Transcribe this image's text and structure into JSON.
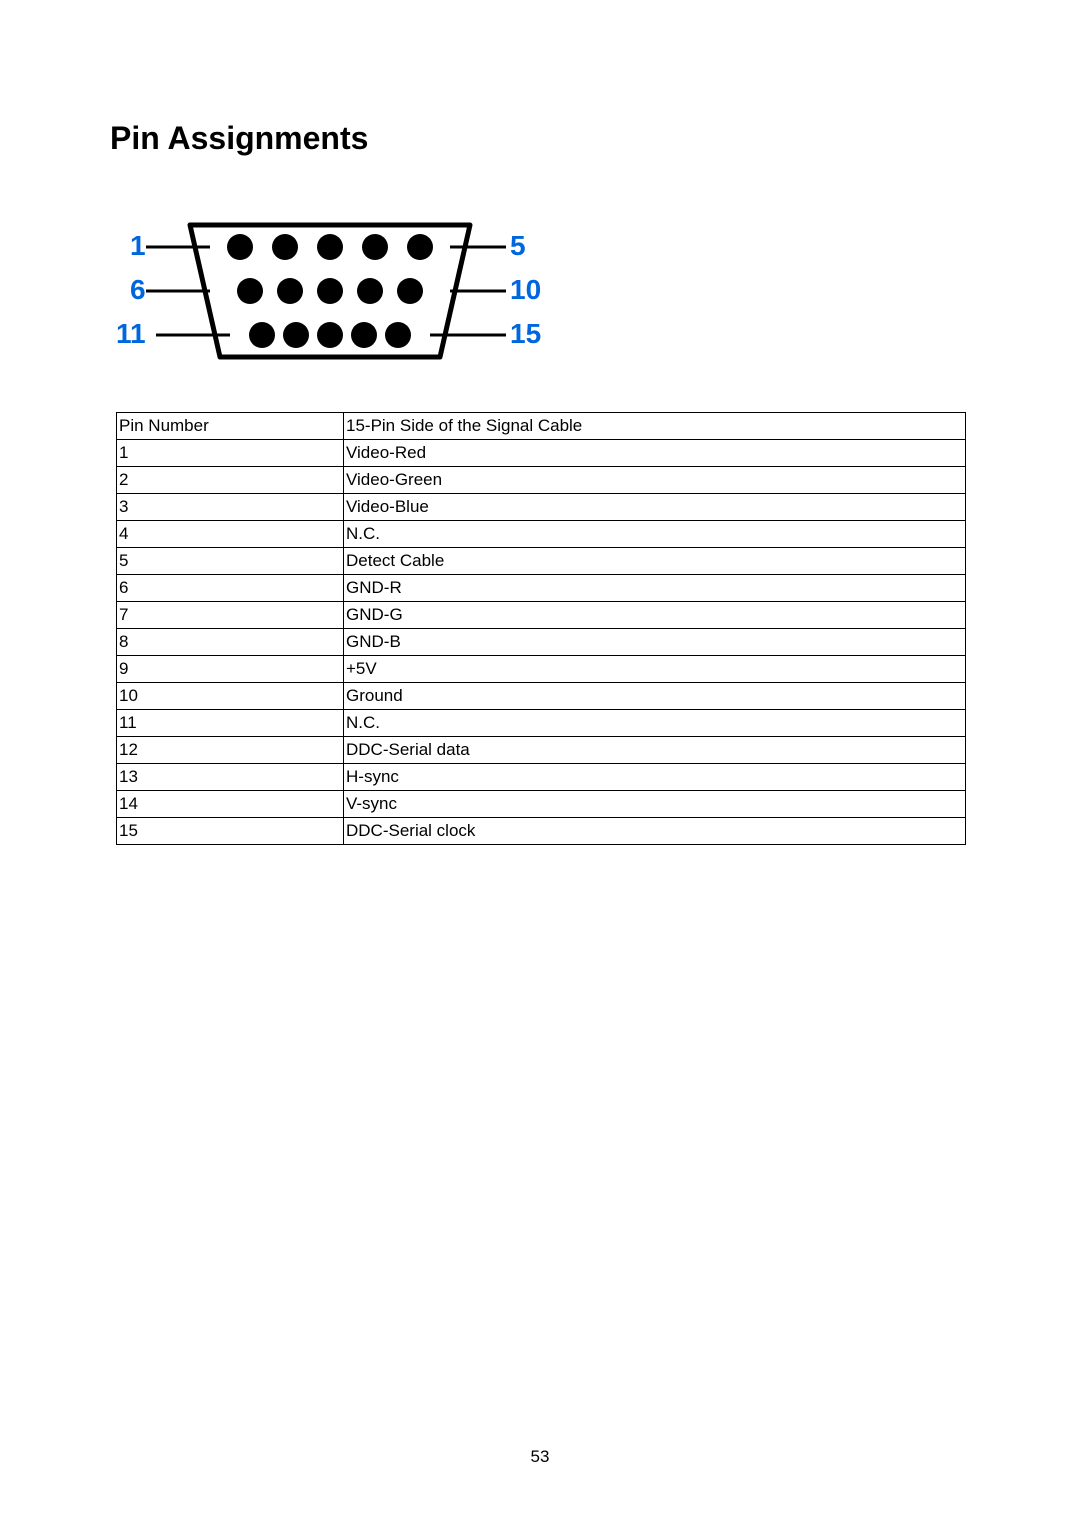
{
  "title": "Pin Assignments",
  "diagram": {
    "labels": {
      "left_top": "1",
      "left_mid": "6",
      "left_bot": "11",
      "right_top": "5",
      "right_mid": "10",
      "right_bot": "15"
    }
  },
  "table": {
    "header": {
      "pin_number": "Pin Number",
      "signal": "15-Pin Side of the Signal Cable"
    },
    "rows": [
      {
        "n": "1",
        "s": "Video-Red"
      },
      {
        "n": "2",
        "s": "Video-Green"
      },
      {
        "n": "3",
        "s": "Video-Blue"
      },
      {
        "n": "4",
        "s": "N.C."
      },
      {
        "n": "5",
        "s": "Detect Cable"
      },
      {
        "n": "6",
        "s": "GND-R"
      },
      {
        "n": "7",
        "s": "GND-G"
      },
      {
        "n": "8",
        "s": "GND-B"
      },
      {
        "n": "9",
        "s": "+5V"
      },
      {
        "n": "10",
        "s": "Ground"
      },
      {
        "n": "11",
        "s": "N.C."
      },
      {
        "n": "12",
        "s": "DDC-Serial data"
      },
      {
        "n": "13",
        "s": "H-sync"
      },
      {
        "n": "14",
        "s": "V-sync"
      },
      {
        "n": "15",
        "s": "DDC-Serial clock"
      }
    ]
  },
  "page_number": "53"
}
